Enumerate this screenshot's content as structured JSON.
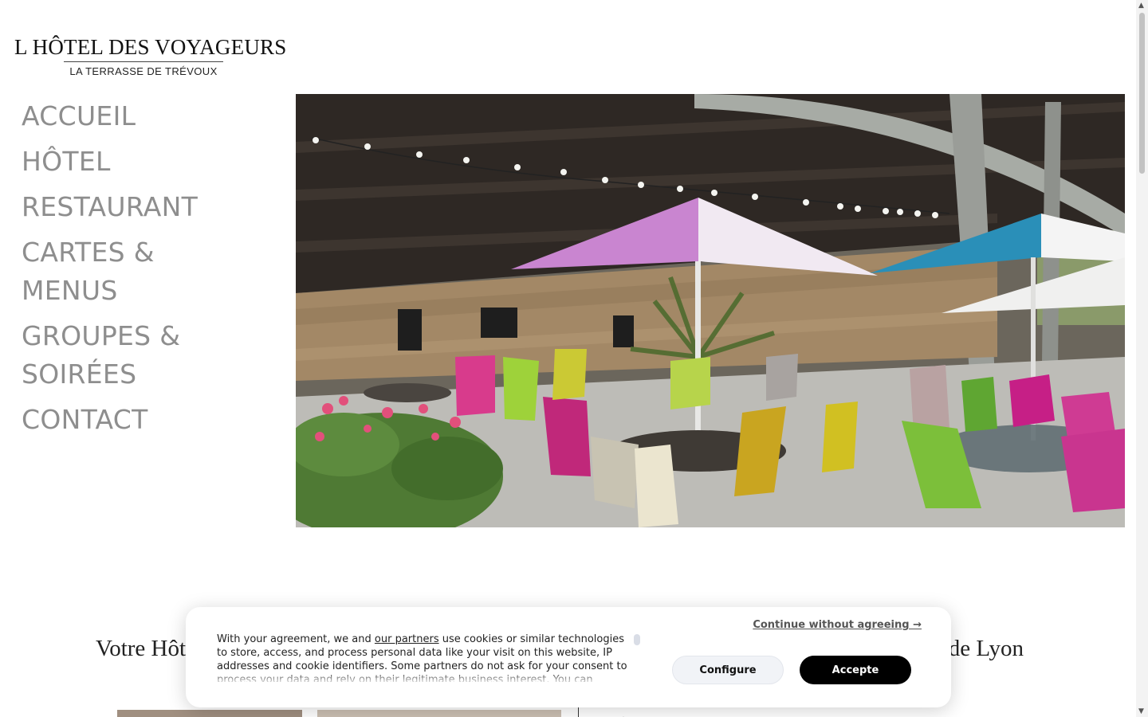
{
  "logo": {
    "title": "L HÔTEL DES VOYAGEURS",
    "subtitle": "LA TERRASSE DE TRÉVOUX"
  },
  "nav": {
    "items": [
      {
        "label": "ACCUEIL"
      },
      {
        "label": "HÔTEL"
      },
      {
        "label": "RESTAURANT"
      },
      {
        "label": "CARTES & MENUS"
      },
      {
        "label": "GROUPES & SOIRÉES"
      },
      {
        "label": "CONTACT"
      }
    ]
  },
  "hero": {
    "image": "terrace-photo-umbrellas-colorful-chairs"
  },
  "main": {
    "heading_left": "Votre Hôt",
    "heading_right": "in de Lyon"
  },
  "cookie": {
    "text_before": "With your agreement, we and ",
    "partners_link": "our partners",
    "text_after": " use cookies or similar technologies to store, access, and process personal data like your visit on this website, IP addresses and cookie identifiers. Some partners do not ask for your consent to process your data and rely on their legitimate business interest. You can",
    "continue_label": "Continue without agreeing →",
    "configure_label": "Configure",
    "accept_label": "Accepte"
  },
  "scrollbar": {
    "up_icon": "▲",
    "down_icon": "▼"
  }
}
